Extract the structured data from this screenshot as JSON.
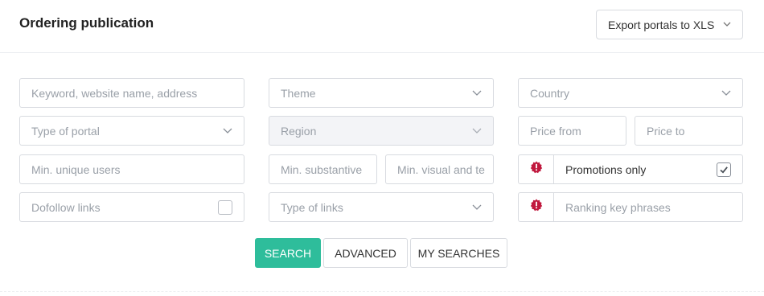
{
  "header": {
    "title": "Ordering publication",
    "export_label": "Export portals to XLS"
  },
  "filters": {
    "keyword_placeholder": "Keyword, website name, address",
    "theme": "Theme",
    "country": "Country",
    "portal_type": "Type of portal",
    "region": "Region",
    "price_from_placeholder": "Price from",
    "price_to_placeholder": "Price to",
    "min_unique_users_placeholder": "Min. unique users",
    "min_substantive_placeholder": "Min. substantive",
    "min_visual_placeholder": "Min. visual and te",
    "promotions_label": "Promotions only",
    "promotions_checked": true,
    "dofollow_label": "Dofollow links",
    "dofollow_checked": false,
    "type_of_links": "Type of links",
    "ranking_placeholder": "Ranking key phrases"
  },
  "actions": {
    "search": "SEARCH",
    "advanced": "ADVANCED",
    "my_searches": "MY SEARCHES"
  },
  "colors": {
    "accent": "#2ebd9b",
    "alert": "#c0183d",
    "placeholder": "#9aa0a8",
    "border": "#d8dbe0"
  }
}
